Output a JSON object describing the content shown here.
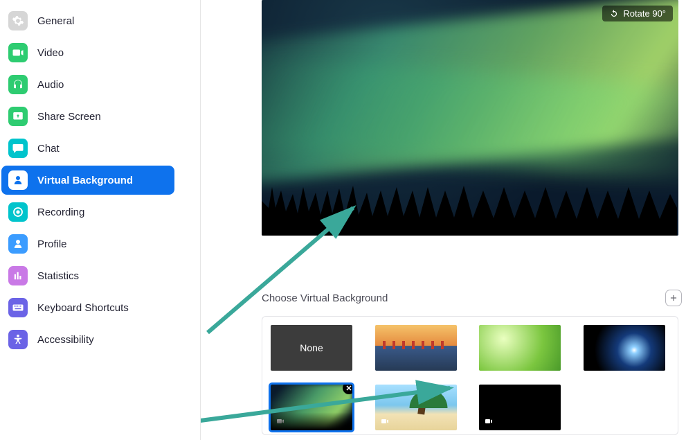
{
  "sidebar": {
    "items": [
      {
        "id": "general",
        "label": "General",
        "icon": "gear-icon",
        "active": false
      },
      {
        "id": "video",
        "label": "Video",
        "icon": "video-icon",
        "active": false
      },
      {
        "id": "audio",
        "label": "Audio",
        "icon": "headphones-icon",
        "active": false
      },
      {
        "id": "share",
        "label": "Share Screen",
        "icon": "share-screen-icon",
        "active": false
      },
      {
        "id": "chat",
        "label": "Chat",
        "icon": "chat-icon",
        "active": false
      },
      {
        "id": "virtualbg",
        "label": "Virtual Background",
        "icon": "person-icon",
        "active": true
      },
      {
        "id": "recording",
        "label": "Recording",
        "icon": "record-icon",
        "active": false
      },
      {
        "id": "profile",
        "label": "Profile",
        "icon": "profile-icon",
        "active": false
      },
      {
        "id": "statistics",
        "label": "Statistics",
        "icon": "stats-icon",
        "active": false
      },
      {
        "id": "keyboard",
        "label": "Keyboard Shortcuts",
        "icon": "keyboard-icon",
        "active": false
      },
      {
        "id": "accessibility",
        "label": "Accessibility",
        "icon": "accessibility-icon",
        "active": false
      }
    ]
  },
  "preview": {
    "rotate_label": "Rotate 90°",
    "image_desc": "aurora-borealis-over-treeline"
  },
  "choose": {
    "title": "Choose Virtual Background",
    "add_label": "Add"
  },
  "backgrounds": [
    {
      "id": "none",
      "label": "None",
      "type": "none",
      "selected": false,
      "is_video": false,
      "removable": false
    },
    {
      "id": "bridge",
      "label": "Golden Gate Bridge",
      "type": "image",
      "selected": false,
      "is_video": false,
      "removable": false
    },
    {
      "id": "grass",
      "label": "Grass",
      "type": "image",
      "selected": false,
      "is_video": false,
      "removable": false
    },
    {
      "id": "earth",
      "label": "Earth from Space",
      "type": "image",
      "selected": false,
      "is_video": false,
      "removable": false
    },
    {
      "id": "aurora",
      "label": "Aurora",
      "type": "video",
      "selected": true,
      "is_video": true,
      "removable": true
    },
    {
      "id": "beach",
      "label": "Beach",
      "type": "video",
      "selected": false,
      "is_video": true,
      "removable": false
    },
    {
      "id": "black",
      "label": "Black",
      "type": "video",
      "selected": false,
      "is_video": true,
      "removable": false
    }
  ],
  "annotations": {
    "arrow_color": "#3aa89a"
  }
}
